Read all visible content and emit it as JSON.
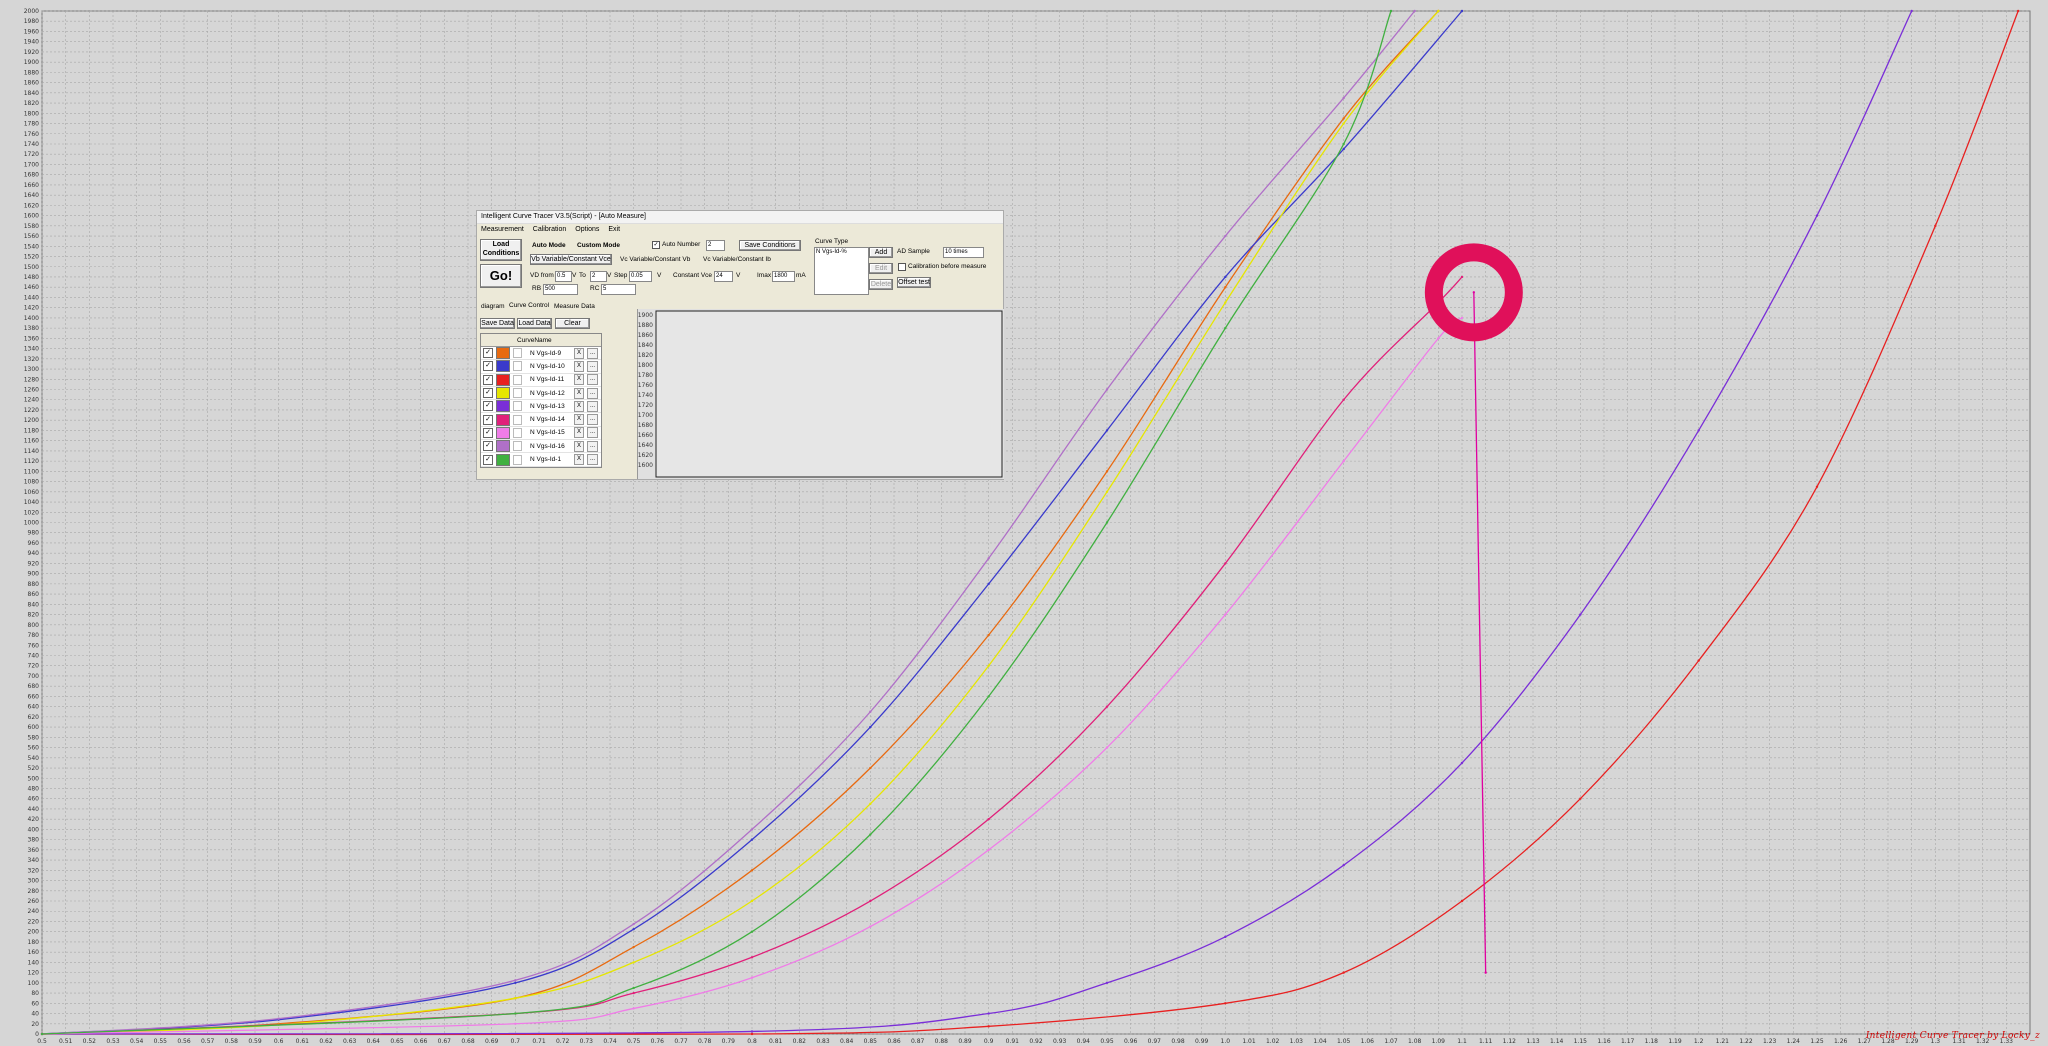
{
  "plot": {
    "x_ticks": [
      "0.5",
      "0.51",
      "0.52",
      "0.53",
      "0.54",
      "0.55",
      "0.56",
      "0.57",
      "0.58",
      "0.59",
      "0.6",
      "0.61",
      "0.62",
      "0.63",
      "0.64",
      "0.65",
      "0.66",
      "0.67",
      "0.68",
      "0.69",
      "0.7",
      "0.71",
      "0.72",
      "0.73",
      "0.74",
      "0.75",
      "0.76",
      "0.77",
      "0.78",
      "0.79",
      "0.8",
      "0.81",
      "0.82",
      "0.83",
      "0.84",
      "0.85",
      "0.86",
      "0.87",
      "0.88",
      "0.89",
      "0.9",
      "0.91",
      "0.92",
      "0.93",
      "0.94",
      "0.95",
      "0.96",
      "0.97",
      "0.98",
      "0.99",
      "1.0",
      "1.01",
      "1.02",
      "1.03",
      "1.04",
      "1.05",
      "1.06",
      "1.07",
      "1.08",
      "1.09",
      "1.1",
      "1.11",
      "1.12",
      "1.13",
      "1.14",
      "1.15",
      "1.16",
      "1.17",
      "1.18",
      "1.19",
      "1.2",
      "1.21",
      "1.22",
      "1.23",
      "1.24",
      "1.25",
      "1.26",
      "1.27",
      "1.28",
      "1.29",
      "1.3",
      "1.31",
      "1.32",
      "1.33"
    ],
    "y_min": 0,
    "y_max": 2000,
    "y_step": 20,
    "grid": true,
    "watermark": "Intelligent Curve Tracer by Locky_z"
  },
  "chart_data": {
    "type": "line",
    "xlim": [
      0.5,
      1.34
    ],
    "ylim": [
      0,
      2000
    ],
    "series": [
      {
        "name": "N Vgs-Id-9",
        "color": "#e86a10",
        "points": [
          [
            0.5,
            0
          ],
          [
            0.6,
            20
          ],
          [
            0.7,
            70
          ],
          [
            0.75,
            170
          ],
          [
            0.8,
            320
          ],
          [
            0.85,
            520
          ],
          [
            0.9,
            780
          ],
          [
            0.95,
            1100
          ],
          [
            1.0,
            1460
          ],
          [
            1.05,
            1790
          ],
          [
            1.09,
            2000
          ]
        ]
      },
      {
        "name": "N Vgs-Id-10",
        "color": "#3a3acc",
        "points": [
          [
            0.5,
            0
          ],
          [
            0.6,
            28
          ],
          [
            0.7,
            100
          ],
          [
            0.75,
            205
          ],
          [
            0.8,
            380
          ],
          [
            0.85,
            600
          ],
          [
            0.9,
            880
          ],
          [
            0.95,
            1180
          ],
          [
            1.0,
            1480
          ],
          [
            1.05,
            1730
          ],
          [
            1.1,
            2000
          ]
        ]
      },
      {
        "name": "N Vgs-Id-11",
        "color": "#e82020",
        "points": [
          [
            0.5,
            0
          ],
          [
            0.8,
            0
          ],
          [
            0.9,
            15
          ],
          [
            1.0,
            60
          ],
          [
            1.05,
            120
          ],
          [
            1.1,
            260
          ],
          [
            1.15,
            460
          ],
          [
            1.2,
            730
          ],
          [
            1.25,
            1070
          ],
          [
            1.3,
            1580
          ],
          [
            1.335,
            2000
          ]
        ]
      },
      {
        "name": "N Vgs-Id-12",
        "color": "#e6e600",
        "points": [
          [
            0.5,
            0
          ],
          [
            0.6,
            18
          ],
          [
            0.7,
            70
          ],
          [
            0.75,
            140
          ],
          [
            0.8,
            260
          ],
          [
            0.85,
            450
          ],
          [
            0.9,
            720
          ],
          [
            0.95,
            1060
          ],
          [
            1.0,
            1430
          ],
          [
            1.05,
            1780
          ],
          [
            1.09,
            2000
          ]
        ]
      },
      {
        "name": "N Vgs-Id-13",
        "color": "#7a2ed8",
        "points": [
          [
            0.5,
            0
          ],
          [
            0.8,
            5
          ],
          [
            0.9,
            40
          ],
          [
            0.95,
            100
          ],
          [
            1.0,
            190
          ],
          [
            1.05,
            330
          ],
          [
            1.1,
            530
          ],
          [
            1.15,
            820
          ],
          [
            1.2,
            1180
          ],
          [
            1.25,
            1600
          ],
          [
            1.29,
            2000
          ]
        ]
      },
      {
        "name": "N Vgs-Id-14",
        "color": "#e0207a",
        "points": [
          [
            0.5,
            0
          ],
          [
            0.7,
            40
          ],
          [
            0.75,
            80
          ],
          [
            0.8,
            150
          ],
          [
            0.85,
            260
          ],
          [
            0.9,
            420
          ],
          [
            0.95,
            640
          ],
          [
            1.0,
            920
          ],
          [
            1.05,
            1240
          ],
          [
            1.09,
            1430
          ],
          [
            1.1,
            1480
          ]
        ]
      },
      {
        "name": "N Vgs-Id-15",
        "color": "#f07ce8",
        "points": [
          [
            0.5,
            0
          ],
          [
            0.7,
            20
          ],
          [
            0.75,
            50
          ],
          [
            0.8,
            110
          ],
          [
            0.85,
            210
          ],
          [
            0.9,
            360
          ],
          [
            0.95,
            560
          ],
          [
            1.0,
            820
          ],
          [
            1.05,
            1120
          ],
          [
            1.09,
            1360
          ],
          [
            1.1,
            1400
          ]
        ]
      },
      {
        "name": "N Vgs-Id-16",
        "color": "#b070c8",
        "points": [
          [
            0.5,
            0
          ],
          [
            0.6,
            30
          ],
          [
            0.7,
            105
          ],
          [
            0.75,
            215
          ],
          [
            0.8,
            400
          ],
          [
            0.85,
            630
          ],
          [
            0.9,
            930
          ],
          [
            0.95,
            1260
          ],
          [
            1.0,
            1560
          ],
          [
            1.05,
            1830
          ],
          [
            1.08,
            2000
          ]
        ]
      },
      {
        "name": "N Vgs-Id-1",
        "color": "#40b040",
        "points": [
          [
            0.5,
            0
          ],
          [
            0.7,
            40
          ],
          [
            0.75,
            90
          ],
          [
            0.8,
            200
          ],
          [
            0.85,
            390
          ],
          [
            0.9,
            660
          ],
          [
            0.95,
            1000
          ],
          [
            1.0,
            1380
          ],
          [
            1.05,
            1740
          ],
          [
            1.07,
            2000
          ]
        ]
      },
      {
        "name": "",
        "color": "#e000a0",
        "points": [
          [
            1.105,
            1450
          ],
          [
            1.11,
            120
          ]
        ]
      }
    ],
    "highlight": {
      "x": 1.105,
      "y": 1450,
      "color": "#e0105a"
    }
  },
  "app": {
    "title": "Intelligent Curve Tracer V3.5(Script) - [Auto Measure]",
    "menu": [
      "Measurement",
      "Calibration",
      "Options",
      "Exit"
    ],
    "load_conditions": "Load Conditions",
    "go": "Go!",
    "auto_mode": "Auto Mode",
    "custom_mode": "Custom Mode",
    "auto_number_label": "Auto Number",
    "auto_number_value": "2",
    "save_conditions": "Save Conditions",
    "mode_tabs": [
      "Vb Variable/Constant Vce",
      "Vc Variable/Constant Vb",
      "Vc Variable/Constant Ib"
    ],
    "vd_from_label": "VD from",
    "vd_from": "0.5",
    "v1": "V",
    "to_label": "To",
    "to_value": "2",
    "v2": "V",
    "step_label": "Step",
    "step_value": "0.05",
    "v3": "V",
    "constant_vce_label": "Constant Vce",
    "constant_vce_value": "24",
    "v4": "V",
    "imax_label": "Imax",
    "imax_value": "1800",
    "ma": "mA",
    "rb_label": "RB",
    "rb_value": "500",
    "rc_label": "RC",
    "rc_value": "5",
    "curve_type_label": "Curve Type",
    "curve_type_value": "N Vgs-Id-%",
    "add": "Add",
    "edit": "Edit",
    "delete": "Delete",
    "ad_sample_label": "AD Sample",
    "ad_sample_value": "10 times",
    "calibration_before": "Calibration before measure",
    "offset_test": "Offset test",
    "lower_tabs": [
      "diagram",
      "Curve Control",
      "Measure Data"
    ],
    "save_data": "Save Data",
    "load_data": "Load Data",
    "clear": "Clear",
    "curve_name_header": "CurveName",
    "x_btn": "X",
    "more_btn": "...",
    "mini_ticks": [
      "1900",
      "1880",
      "1860",
      "1840",
      "1820",
      "1800",
      "1780",
      "1760",
      "1740",
      "1720",
      "1700",
      "1680",
      "1660",
      "1640",
      "1620",
      "1600"
    ]
  }
}
